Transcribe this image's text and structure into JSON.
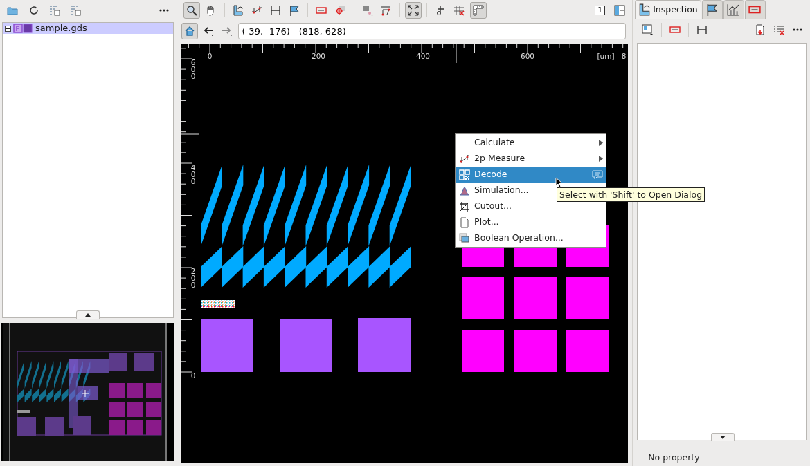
{
  "library_panel": {
    "tree": [
      {
        "label": "sample.gds",
        "selected": true,
        "expanded": false
      }
    ]
  },
  "main_toolbar": {
    "tools": [
      {
        "pressed": true
      },
      {
        "pressed": false
      },
      {
        "pressed": false
      },
      {
        "pressed": false
      },
      {
        "pressed": false
      },
      {
        "pressed": false
      },
      {
        "pressed": false
      },
      {
        "pressed": false
      },
      {
        "pressed": false
      },
      {
        "pressed": false
      },
      {
        "pressed": true
      },
      {
        "pressed": false
      },
      {
        "pressed": false
      },
      {
        "pressed": true
      }
    ],
    "view_button": "1"
  },
  "navigation": {
    "coordinates": "(-39, -176) - (818, 628)"
  },
  "canvas": {
    "x_ruler": [
      "0",
      "200",
      "400",
      "600",
      "[um]",
      "8"
    ],
    "y_ruler": [
      "600",
      "400",
      "200",
      "0"
    ]
  },
  "context_menu": {
    "items": [
      {
        "label": "Calculate",
        "submenu": true,
        "selected": false,
        "hint": false
      },
      {
        "label": "2p Measure",
        "submenu": true,
        "selected": false,
        "hint": false
      },
      {
        "label": "Decode",
        "submenu": false,
        "selected": true,
        "hint": true
      },
      {
        "label": "Simulation...",
        "submenu": false,
        "selected": false,
        "hint": false
      },
      {
        "label": "Cutout...",
        "submenu": false,
        "selected": false,
        "hint": false
      },
      {
        "label": "Plot...",
        "submenu": false,
        "selected": false,
        "hint": false
      },
      {
        "label": "Boolean Operation...",
        "submenu": false,
        "selected": false,
        "hint": false
      }
    ]
  },
  "tooltip": "Select with 'Shift' to Open Dialog",
  "inspector": {
    "tabs": [
      {
        "label": "Inspection",
        "selected": true
      },
      {
        "selected": false
      },
      {
        "selected": false
      },
      {
        "selected": false
      }
    ],
    "status": "No property"
  }
}
